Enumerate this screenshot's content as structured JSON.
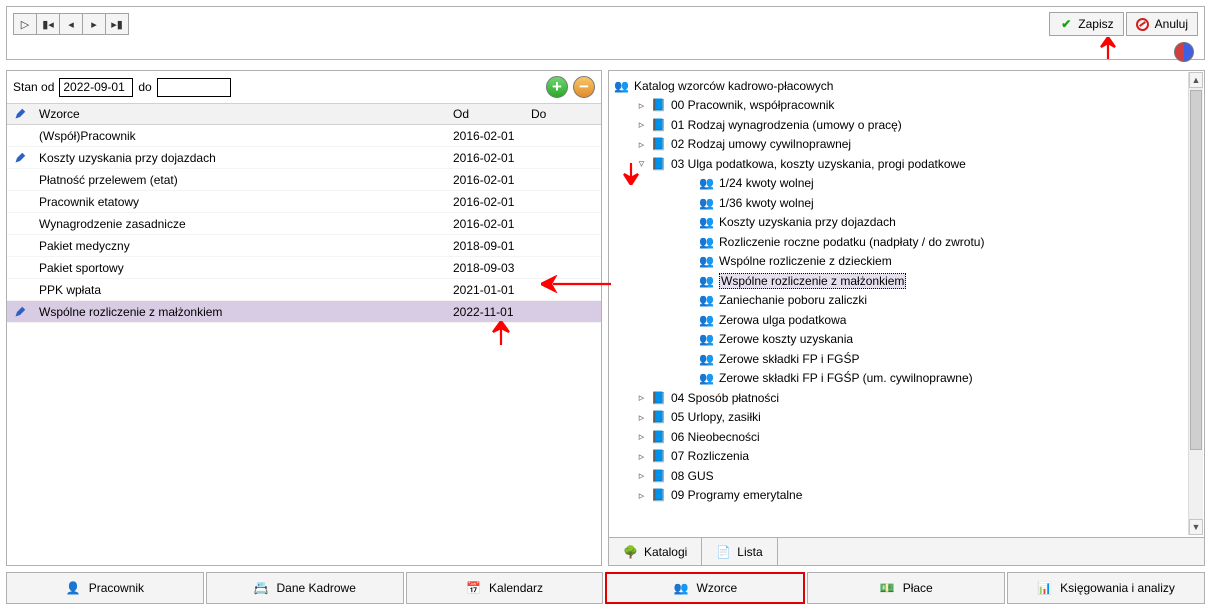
{
  "toolbar": {
    "save_label": "Zapisz",
    "cancel_label": "Anuluj"
  },
  "filter": {
    "stan_od_label": "Stan od",
    "stan_od_value": "2022-09-01",
    "do_label": "do",
    "do_value": ""
  },
  "grid": {
    "headers": {
      "wzorce": "Wzorce",
      "od": "Od",
      "do": "Do"
    },
    "rows": [
      {
        "name": "(Współ)Pracownik",
        "od": "2016-02-01",
        "do": "",
        "pencil": false,
        "selected": false
      },
      {
        "name": "Koszty uzyskania przy dojazdach",
        "od": "2016-02-01",
        "do": "",
        "pencil": true,
        "selected": false
      },
      {
        "name": "Płatność przelewem (etat)",
        "od": "2016-02-01",
        "do": "",
        "pencil": false,
        "selected": false
      },
      {
        "name": "Pracownik etatowy",
        "od": "2016-02-01",
        "do": "",
        "pencil": false,
        "selected": false
      },
      {
        "name": "Wynagrodzenie zasadnicze",
        "od": "2016-02-01",
        "do": "",
        "pencil": false,
        "selected": false
      },
      {
        "name": "Pakiet medyczny",
        "od": "2018-09-01",
        "do": "",
        "pencil": false,
        "selected": false
      },
      {
        "name": "Pakiet sportowy",
        "od": "2018-09-03",
        "do": "",
        "pencil": false,
        "selected": false
      },
      {
        "name": "PPK wpłata",
        "od": "2021-01-01",
        "do": "",
        "pencil": false,
        "selected": false
      },
      {
        "name": "Wspólne rozliczenie z małżonkiem",
        "od": "2022-11-01",
        "do": "",
        "pencil": true,
        "selected": true
      }
    ]
  },
  "tree": {
    "root": "Katalog wzorców kadrowo-płacowych",
    "nodes": [
      {
        "depth": 1,
        "expander": "▹",
        "icon": "book-blue",
        "label": "00 Pracownik, współpracownik"
      },
      {
        "depth": 1,
        "expander": "▹",
        "icon": "book-blue",
        "label": "01 Rodzaj wynagrodzenia (umowy o pracę)"
      },
      {
        "depth": 1,
        "expander": "▹",
        "icon": "book-blue",
        "label": "02 Rodzaj umowy cywilnoprawnej"
      },
      {
        "depth": 1,
        "expander": "▿",
        "icon": "book-blue",
        "label": "03 Ulga podatkowa, koszty uzyskania, progi podatkowe"
      },
      {
        "depth": 2,
        "expander": "",
        "icon": "ppl",
        "label": "1/24 kwoty wolnej"
      },
      {
        "depth": 2,
        "expander": "",
        "icon": "ppl",
        "label": "1/36 kwoty wolnej"
      },
      {
        "depth": 2,
        "expander": "",
        "icon": "ppl",
        "label": "Koszty uzyskania przy dojazdach"
      },
      {
        "depth": 2,
        "expander": "",
        "icon": "ppl",
        "label": "Rozliczenie roczne podatku (nadpłaty / do zwrotu)"
      },
      {
        "depth": 2,
        "expander": "",
        "icon": "ppl",
        "label": "Wspólne rozliczenie z dzieckiem"
      },
      {
        "depth": 2,
        "expander": "",
        "icon": "ppl",
        "label": "Wspólne rozliczenie z małżonkiem",
        "selected": true
      },
      {
        "depth": 2,
        "expander": "",
        "icon": "ppl",
        "label": "Zaniechanie poboru zaliczki"
      },
      {
        "depth": 2,
        "expander": "",
        "icon": "ppl",
        "label": "Zerowa ulga podatkowa"
      },
      {
        "depth": 2,
        "expander": "",
        "icon": "ppl",
        "label": "Zerowe koszty uzyskania"
      },
      {
        "depth": 2,
        "expander": "",
        "icon": "ppl",
        "label": "Zerowe składki FP i FGŚP"
      },
      {
        "depth": 2,
        "expander": "",
        "icon": "ppl",
        "label": "Zerowe składki FP i FGŚP (um. cywilnoprawne)"
      },
      {
        "depth": 1,
        "expander": "▹",
        "icon": "book-blue",
        "label": "04 Sposób płatności"
      },
      {
        "depth": 1,
        "expander": "▹",
        "icon": "book-blue",
        "label": "05 Urlopy, zasiłki"
      },
      {
        "depth": 1,
        "expander": "▹",
        "icon": "book-blue",
        "label": "06 Nieobecności"
      },
      {
        "depth": 1,
        "expander": "▹",
        "icon": "book-blue",
        "label": "07 Rozliczenia"
      },
      {
        "depth": 1,
        "expander": "▹",
        "icon": "book-blue",
        "label": "08 GUS"
      },
      {
        "depth": 1,
        "expander": "▹",
        "icon": "book-blue",
        "label": "09 Programy emerytalne"
      }
    ]
  },
  "right_tabs": {
    "katalogi": "Katalogi",
    "lista": "Lista"
  },
  "bottom_tabs": {
    "pracownik": "Pracownik",
    "dane_kadrowe": "Dane Kadrowe",
    "kalendarz": "Kalendarz",
    "wzorce": "Wzorce",
    "place": "Płace",
    "ksiegowania": "Księgowania i analizy"
  }
}
